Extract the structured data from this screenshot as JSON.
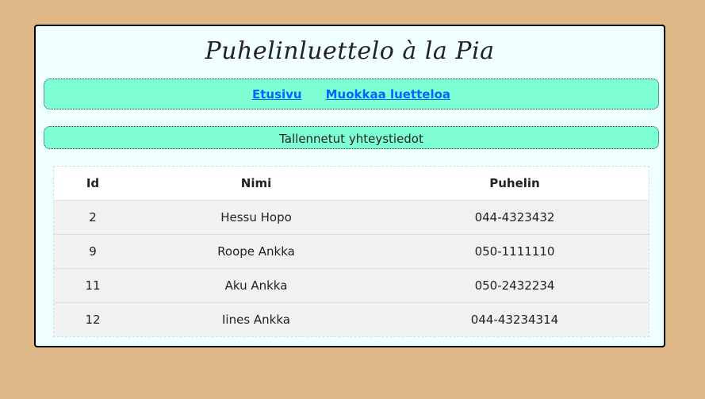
{
  "app": {
    "title": "Puhelinluettelo à la Pia"
  },
  "nav": {
    "home_label": "Etusivu",
    "edit_label": "Muokkaa luetteloa"
  },
  "section": {
    "title": "Tallennetut yhteystiedot"
  },
  "table": {
    "headers": [
      "Id",
      "Nimi",
      "Puhelin"
    ],
    "rows": [
      {
        "id": "2",
        "name": "Hessu Hopo",
        "phone": "044-4323432"
      },
      {
        "id": "9",
        "name": "Roope Ankka",
        "phone": "050-1111110"
      },
      {
        "id": "11",
        "name": "Aku Ankka",
        "phone": "050-2432234"
      },
      {
        "id": "12",
        "name": "Iines Ankka",
        "phone": "044-43234314"
      }
    ]
  },
  "colors": {
    "page_background": "#deb887",
    "panel_background": "#f0ffff",
    "accent": "#7fffd4",
    "link": "#0066ff"
  }
}
